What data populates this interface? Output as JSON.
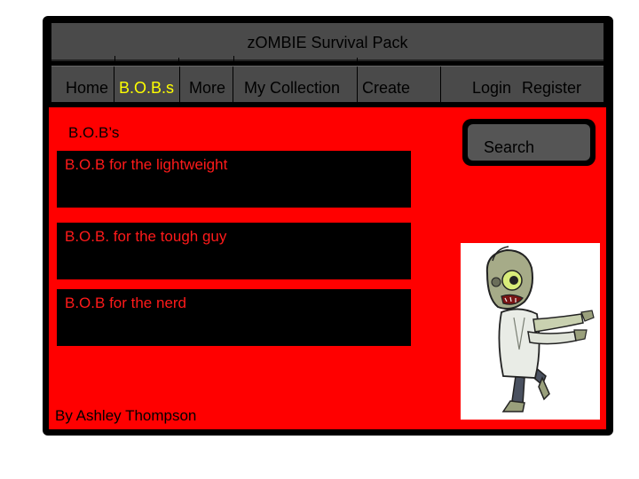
{
  "header": {
    "title": "zOMBIE Survival Pack"
  },
  "nav": {
    "home": "Home",
    "bobs": "B.O.B.s",
    "more": "More",
    "collection": "My Collection",
    "create": "Create",
    "login": "Login",
    "register": "Register"
  },
  "main": {
    "heading": "B.O.B’s",
    "items": [
      {
        "label": "B.O.B for the lightweight"
      },
      {
        "label": "B.O.B. for the tough guy"
      },
      {
        "label": "B.O.B for the nerd"
      }
    ]
  },
  "search": {
    "label": "Search"
  },
  "footer": {
    "credit": "By Ashley Thompson"
  },
  "colors": {
    "frame": "#000000",
    "bar": "#4a4a4a",
    "content": "#ff0000",
    "active_nav": "#ffff00",
    "item_text": "#ff1a1a"
  },
  "illustration": {
    "icon": "zombie-illustration"
  }
}
